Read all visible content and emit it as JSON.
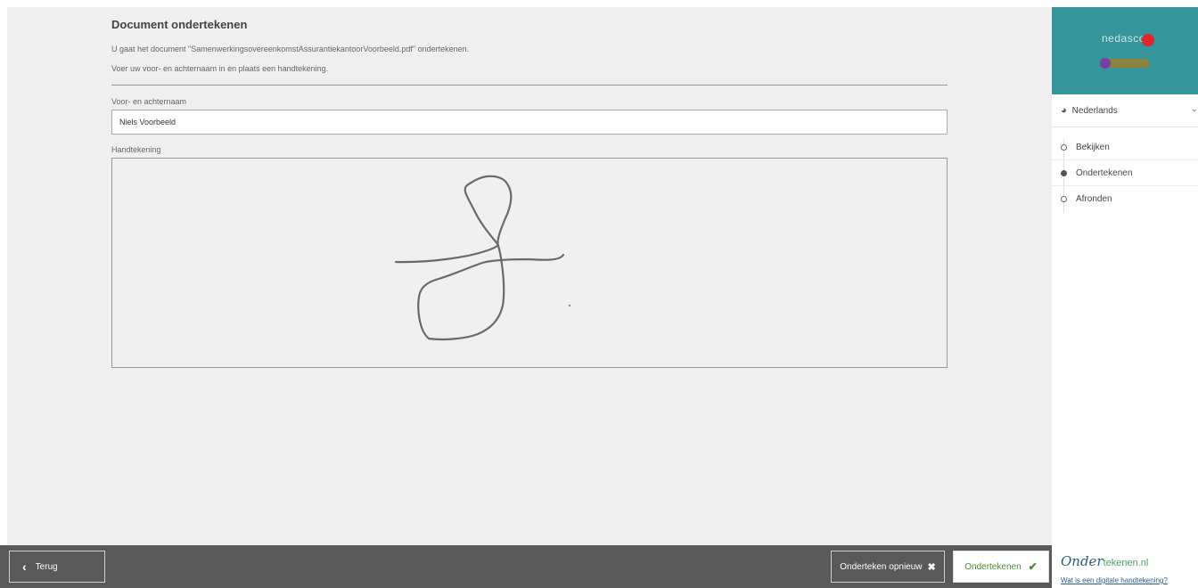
{
  "main": {
    "title": "Document ondertekenen",
    "intro_line1": "U gaat het document \"SamenwerkingsovereenkomstAssurantiekantoorVoorbeeld.pdf\" ondertekenen.",
    "intro_line2": "Voer uw voor- en achternaam in en plaats een handtekening.",
    "name_field": {
      "label": "Voor- en achternaam",
      "value": "Niels Voorbeeld"
    },
    "signature": {
      "label": "Handtekening"
    }
  },
  "bottom_bar": {
    "back_label": "Terug",
    "resign_label": "Onderteken opnieuw",
    "sign_label": "Ondertekenen"
  },
  "sidebar": {
    "brand": "nedasco",
    "language": "Nederlands",
    "steps": [
      {
        "label": "Bekijken",
        "active": false
      },
      {
        "label": "Ondertekenen",
        "active": true
      },
      {
        "label": "Afronden",
        "active": false
      }
    ],
    "footer_logo_main": "Onder",
    "footer_logo_suffix": "tekenen.nl",
    "help_link": "Wat is een digitale handtekening?"
  },
  "colors": {
    "accent": "#36959a",
    "bottom_bar": "#595959",
    "sign_green": "#4a8a2c"
  },
  "icons": {
    "back": "chevron-left-icon",
    "resign": "close-icon",
    "sign": "checkmark-icon",
    "language": "globe-icon",
    "language_dropdown": "chevron-down-icon"
  }
}
